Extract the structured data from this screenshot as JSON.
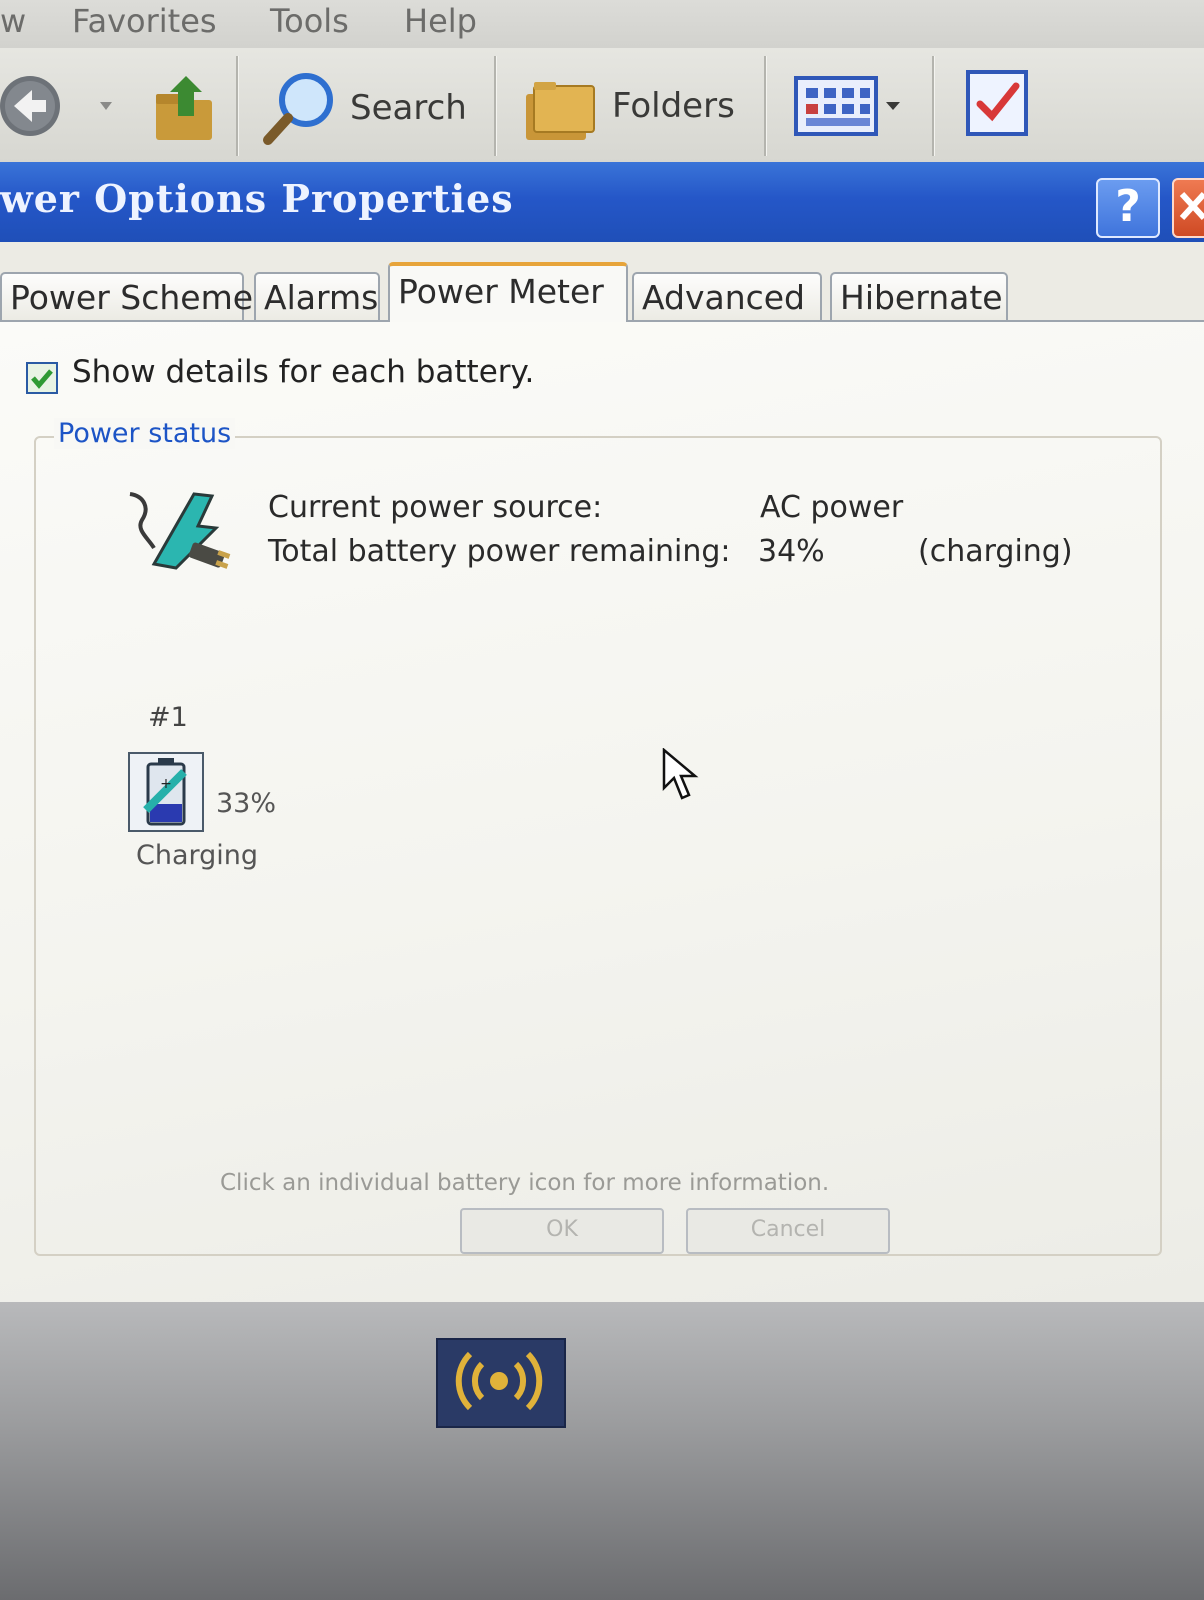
{
  "menubar": {
    "items": [
      "w",
      "Favorites",
      "Tools",
      "Help"
    ]
  },
  "toolbar": {
    "search_label": "Search",
    "folders_label": "Folders"
  },
  "dialog": {
    "title": "wer Options Properties",
    "help_glyph": "?",
    "tabs": [
      "Power Schemes",
      "Alarms",
      "Power Meter",
      "Advanced",
      "Hibernate"
    ],
    "active_tab": "Power Meter",
    "show_details_label": "Show details for each battery.",
    "show_details_checked": true,
    "group_title": "Power status",
    "current_source_label": "Current power source:",
    "current_source_value": "AC power",
    "total_remaining_label": "Total battery power remaining:",
    "total_remaining_value": "34%",
    "total_remaining_state": "(charging)",
    "battery": {
      "number": "#1",
      "percent": "33%",
      "status": "Charging"
    },
    "hint": "Click an individual battery icon for more information.",
    "ok_label": "OK",
    "cancel_label": "Cancel"
  },
  "colors": {
    "titlebar": "#2557c8",
    "tab_highlight": "#e7a43a",
    "group_title": "#1c54c6"
  },
  "icons": [
    "back-arrow-icon",
    "up-folder-icon",
    "search-icon",
    "folders-icon",
    "views-icon",
    "checklist-icon",
    "power-plug-icon",
    "battery-icon",
    "mouse-cursor-icon",
    "wireless-icon"
  ]
}
